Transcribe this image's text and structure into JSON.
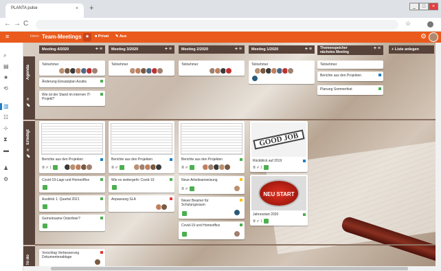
{
  "browser": {
    "tab_title": "PLANTA pulse",
    "tab_close": "×",
    "new_tab": "+",
    "back": "←",
    "forward": "→",
    "reload": "C",
    "bookmark_star": "☆",
    "window_buttons": [
      "_",
      "□",
      "×"
    ]
  },
  "app": {
    "menu_icon": "≡",
    "breadcrumb": "Intern",
    "title": "Team-Meetings",
    "star": "★",
    "buttons": [
      {
        "icon": "■",
        "label": "Privat"
      },
      {
        "icon": "✎",
        "label": "Aus"
      }
    ],
    "settings_icon": "⚙"
  },
  "sidebar": {
    "icons": [
      "⌕",
      "▤",
      "★",
      "⟲",
      "▥",
      "☷",
      "⊹",
      "⧗",
      "▬",
      "♟",
      "⚙"
    ]
  },
  "rows": [
    {
      "label": "Agenda",
      "icon": "✎ ≡"
    },
    {
      "label": "Erledigt",
      "icon": "✎ ≡"
    },
    {
      "label": "To do",
      "icon": ""
    }
  ],
  "columns": [
    {
      "title": "Meeting 4/2020",
      "icons": "+ ≡"
    },
    {
      "title": "Meeting 3/2020",
      "icons": "+ ≡"
    },
    {
      "title": "Meeting 2/2020",
      "icons": "+ ≡"
    },
    {
      "title": "Meeting 1/2020",
      "icons": "+ ≡"
    },
    {
      "title": "Themenspeicher nächstes Meeting",
      "icons": "+ ≡"
    }
  ],
  "add_list": "+ Liste anlegen",
  "cards": {
    "teilnehmer": "Teilnehmer",
    "c1a": "Änderung Einsatzplan Azubis",
    "c1b": "Wie ist der Stand im internen IT-Projekt?",
    "c5a": "Berichte aus den Projekten",
    "c5b": "Planung Sommerfest",
    "berichte": "Berichte aus den Projekten",
    "r2c1b": "Covid-19-Lage und Homeoffice",
    "r2c1c": "Ausblick 1. Quartal 2021",
    "r2c1d": "Gemeinsame Osterfeier?",
    "r2c2b": "Wie es weitergeht: Covid-19",
    "r2c2c": "Anpassung SLA",
    "r2c3b": "Neue Arbeitsanweisung",
    "r2c3c": "Neuer Beamer für Schulungsraum",
    "r2c3d": "Covid-19 und Homeoffice",
    "r2c4a": "Rückblick auf 2019",
    "r2c4b": "Jahresstart 2020",
    "goodjob": "GOOD JOB",
    "neustart": "NEU START",
    "r3c1": "Vorschlag Verbesserung Dokumentenablage",
    "meta_count": "1",
    "meta_icons": "≣ ✐"
  },
  "colors": {
    "accent": "#ea5a1c",
    "header": "#58433a",
    "green": "#4caf50",
    "blue": "#1e7fc6",
    "red": "#e53935",
    "yellow": "#f9c21a"
  }
}
